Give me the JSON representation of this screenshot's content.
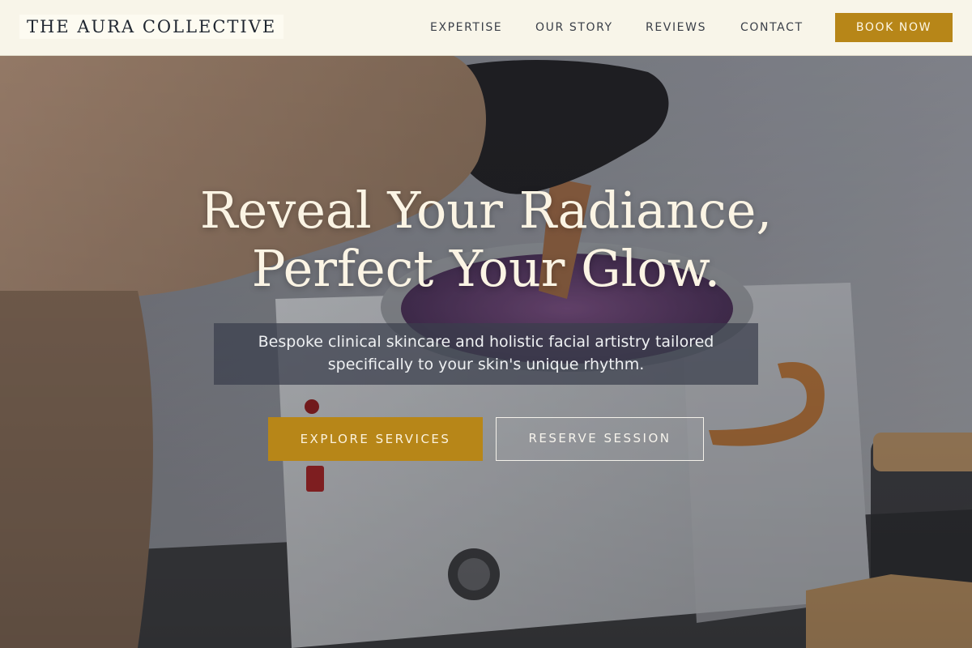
{
  "header": {
    "brand": "THE AURA COLLECTIVE",
    "nav": [
      "EXPERTISE",
      "OUR STORY",
      "REVIEWS",
      "CONTACT"
    ],
    "cta": "BOOK NOW"
  },
  "hero": {
    "headline_line1": "Reveal Your Radiance,",
    "headline_line2": "Perfect Your Glow.",
    "subtitle": "Bespoke clinical skincare and holistic facial artistry tailored specifically to your skin's unique rhythm.",
    "primary_button": "EXPLORE SERVICES",
    "secondary_button": "RESERVE SESSION",
    "background_image": "photo-of-gloved-hand-stirring-wax-warmer"
  },
  "colors": {
    "accent": "#b78618",
    "header_bg": "#f8f5e9",
    "headline": "#fbf4e4"
  }
}
